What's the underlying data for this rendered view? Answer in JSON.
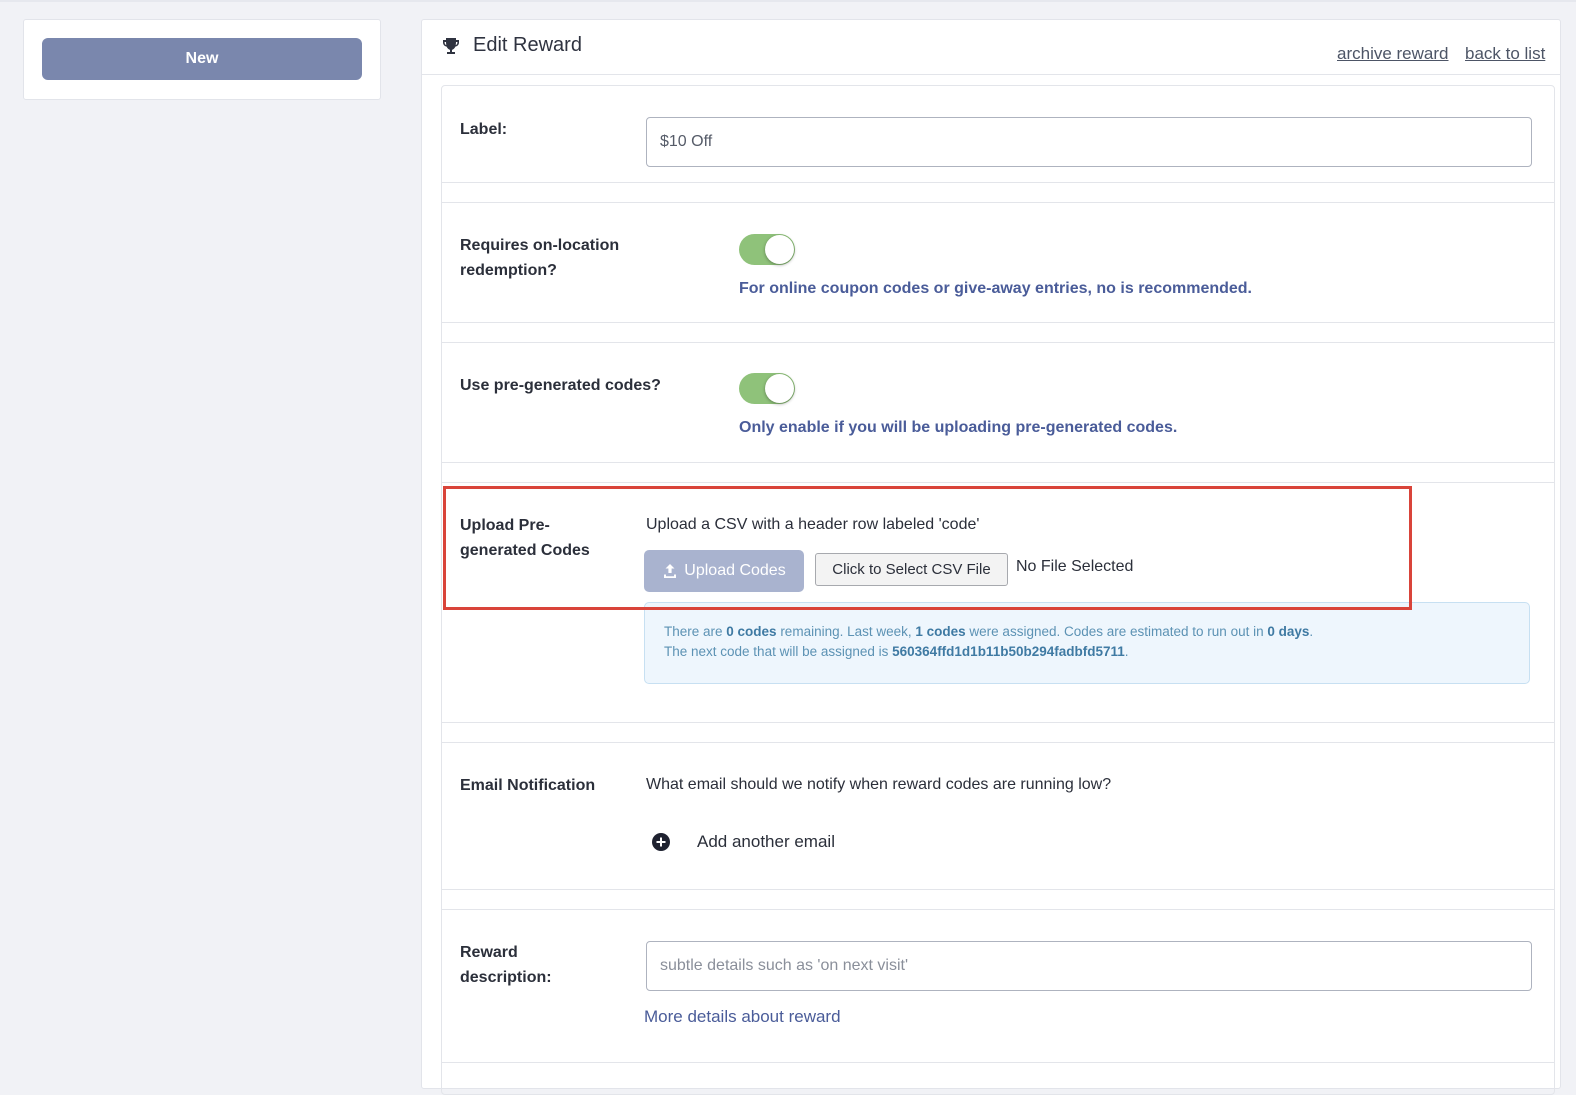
{
  "sidebar": {
    "new_label": "New"
  },
  "header": {
    "title": "Edit Reward",
    "archive_link": "archive reward",
    "back_link": "back to list"
  },
  "form": {
    "label_field": {
      "label": "Label:",
      "value": "$10 Off"
    },
    "on_location": {
      "label_line1": "Requires on-location",
      "label_line2": "redemption?",
      "enabled": true,
      "hint": "For online coupon codes or give-away entries, no is recommended."
    },
    "pregenerated": {
      "label": "Use pre-generated codes?",
      "enabled": true,
      "hint": "Only enable if you will be uploading pre-generated codes."
    },
    "upload": {
      "label_line1": "Upload Pre-",
      "label_line2": "generated Codes",
      "description": "Upload a CSV with a header row labeled 'code'",
      "upload_button": "Upload Codes",
      "select_button": "Click to Select CSV File",
      "file_status": "No File Selected",
      "info": {
        "t1": "There are ",
        "codes_remaining": "0 codes",
        "t2": " remaining. Last week, ",
        "codes_assigned": "1 codes",
        "t3": " were assigned. Codes are estimated to run out in ",
        "days": "0 days",
        "t4": ".",
        "t5": "The next code that will be assigned is ",
        "next_code": "560364ffd1d1b11b50b294fadbfd5711",
        "t6": "."
      }
    },
    "email": {
      "label": "Email Notification",
      "question": "What email should we notify when reward codes are running low?",
      "add_label": "Add another email"
    },
    "description": {
      "label_line1": "Reward",
      "label_line2": "description:",
      "placeholder": "subtle details such as 'on next visit'",
      "more_link": "More details about reward"
    }
  },
  "colors": {
    "accent": "#7a87ad",
    "toggle_on": "#8fc27a",
    "hint_text": "#4a5c99",
    "highlight": "#d9443a",
    "info_bg": "#eef6fd"
  }
}
